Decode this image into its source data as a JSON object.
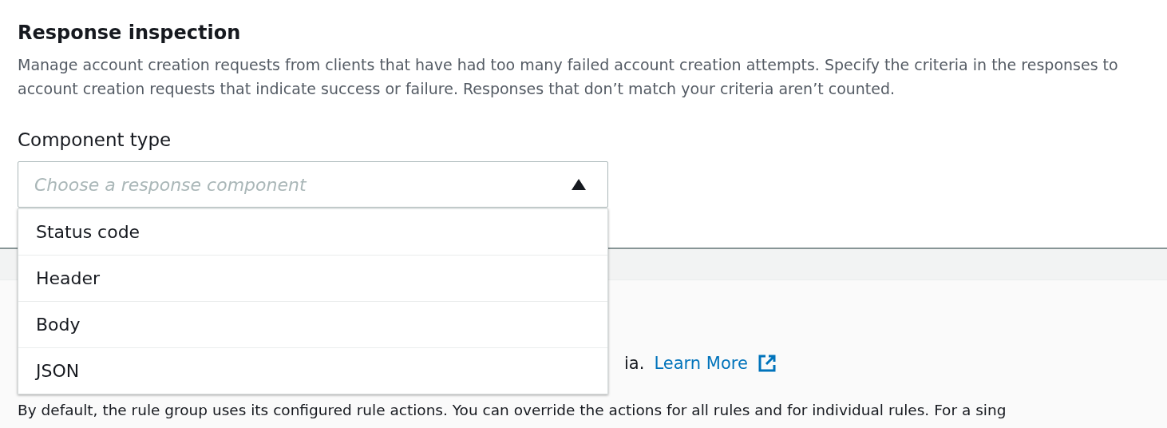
{
  "section": {
    "title": "Response inspection",
    "description": "Manage account creation requests from clients that have had too many failed account creation attempts. Specify the criteria in the responses to account creation requests that indicate success or failure. Responses that don’t match your criteria aren’t counted."
  },
  "component_type": {
    "label": "Component type",
    "placeholder": "Choose a response component",
    "expanded": true,
    "options": [
      {
        "label": "Status code",
        "selected": false
      },
      {
        "label": "Header",
        "selected": false
      },
      {
        "label": "Body",
        "selected": false
      },
      {
        "label": "JSON",
        "selected": false
      }
    ]
  },
  "lower_section": {
    "text_fragment": "ia.",
    "link": "Learn More",
    "note": "By default, the rule group uses its configured rule actions. You can override the actions for all rules and for individual rules. For a sing"
  }
}
